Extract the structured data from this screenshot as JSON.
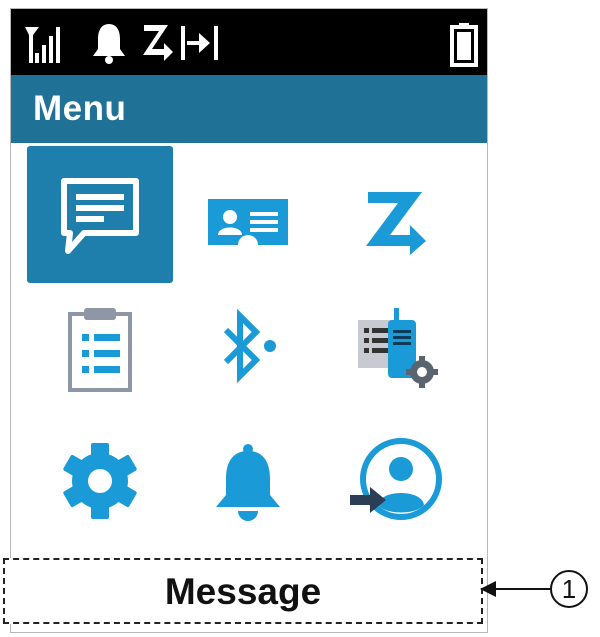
{
  "status_bar": {
    "icons": [
      "signal-strength-icon",
      "bell-icon",
      "scan-icon",
      "talkaround-icon",
      "battery-icon"
    ]
  },
  "header": {
    "title": "Menu"
  },
  "menu": {
    "items": [
      {
        "icon": "message-icon",
        "selected": true
      },
      {
        "icon": "contacts-icon",
        "selected": false
      },
      {
        "icon": "scan-icon",
        "selected": false
      },
      {
        "icon": "clipboard-list-icon",
        "selected": false
      },
      {
        "icon": "bluetooth-icon",
        "selected": false
      },
      {
        "icon": "radio-settings-icon",
        "selected": false
      },
      {
        "icon": "gear-icon",
        "selected": false
      },
      {
        "icon": "bell-icon",
        "selected": false
      },
      {
        "icon": "user-login-icon",
        "selected": false
      }
    ]
  },
  "selected_label": "Message",
  "callout": {
    "number": "1"
  },
  "colors": {
    "header_bg": "#1f7296",
    "selected_tile_bg": "#1f7fac",
    "icon_blue": "#1a9ad6",
    "status_bar_bg": "#000000"
  }
}
